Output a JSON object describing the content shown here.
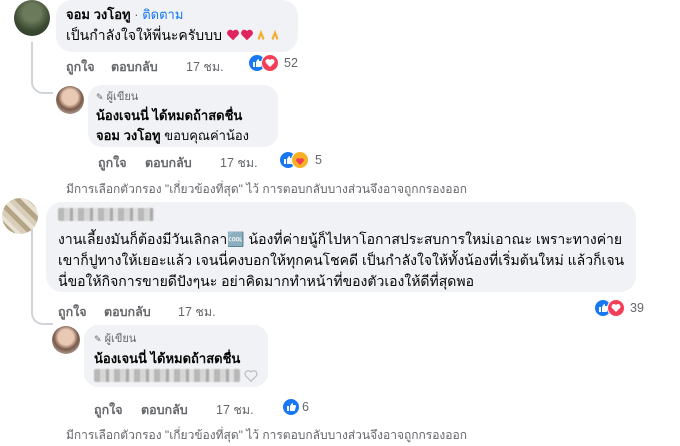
{
  "comments": [
    {
      "author": "จอม วงโอทู",
      "follow_label": "ติดตาม",
      "text": "เป็นกำลังใจให้พี่นะครับบบ",
      "like_label": "ถูกใจ",
      "reply_label": "ตอบกลับ",
      "time": "17 ชม.",
      "reaction_count": "52",
      "reply": {
        "author_tag": "ผู้เขียน",
        "author": "น้องเจนนี่ ได้หมดถ้าสดชื่น",
        "mention": "จอม วงโอทู",
        "text": "ขอบคุณค่าน้อง",
        "like_label": "ถูกใจ",
        "reply_label": "ตอบกลับ",
        "time": "17 ชม.",
        "reaction_count": "5"
      }
    },
    {
      "author": "",
      "text": "งานเลี้ยงมันก็ต้องมีวันเลิกลา🆒 น้องที่ค่ายนู้ก็ไปหาโอกาสประสบการใหม่เอาณะ เพราะทางค่ายเขาก็ปูทางให้เยอะแล้ว เจนนี่คงบอกให้ทุกคนโชคดี เป็นกำลังใจให้ทั้งน้องที่เริ่มต้นใหม่ แล้วก็เจนนี่ขอให้กิจการขายดีปังๆนะ อย่าคิดมากทำหน้าที่ของตัวเองให้ดีที่สุดพอ",
      "like_label": "ถูกใจ",
      "reply_label": "ตอบกลับ",
      "time": "17 ชม.",
      "reaction_count": "39",
      "reply": {
        "author_tag": "ผู้เขียน",
        "author": "น้องเจนนี่ ได้หมดถ้าสดชื่น",
        "like_label": "ถูกใจ",
        "reply_label": "ตอบกลับ",
        "time": "17 ชม.",
        "reaction_count": "6"
      }
    }
  ],
  "filter_notice": "มีการเลือกตัวกรอง \"เกี่ยวข้องที่สุด\" ไว้ การตอบกลับบางส่วนจึงอาจถูกกรองออก",
  "colors": {
    "like_blue": "#1877f2",
    "love_red": "#f33e58",
    "bubble": "#f0f2f5",
    "muted": "#65676b"
  }
}
